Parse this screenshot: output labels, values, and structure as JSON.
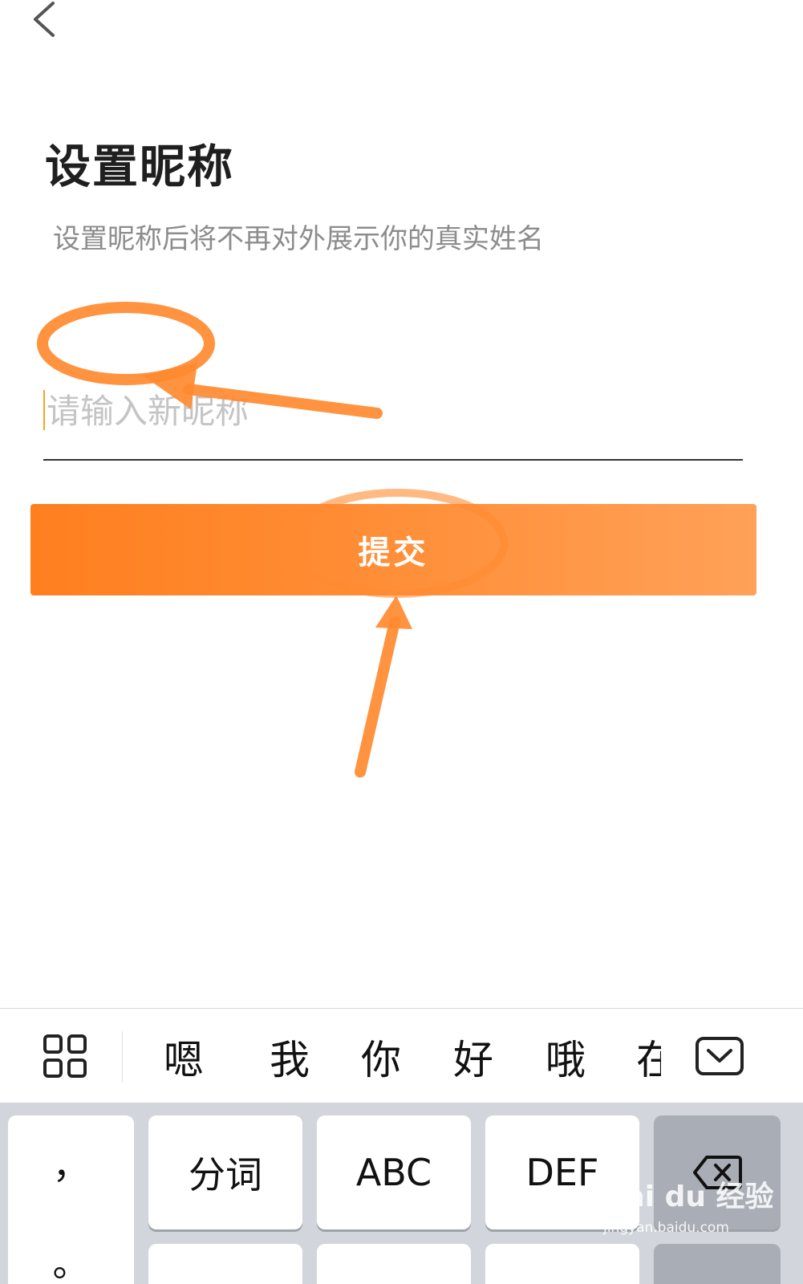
{
  "header": {
    "title": "设置昵称",
    "subtitle": "设置昵称后将不再对外展示你的真实姓名"
  },
  "form": {
    "nickname_placeholder": "请输入新昵称",
    "nickname_value": "",
    "submit_label": "提交"
  },
  "keyboard": {
    "candidates": [
      "嗯",
      "我",
      "你",
      "好",
      "哦",
      "在"
    ],
    "keys": {
      "punct_top": "，",
      "punct_bottom": "。",
      "segment": "分词",
      "abc": "ABC",
      "def": "DEF"
    }
  },
  "watermark": {
    "text": "Bai du 经验",
    "url": "jingyan.baidu.com"
  },
  "colors": {
    "accent": "#ff8a2b",
    "annotation": "#ff8a30"
  }
}
